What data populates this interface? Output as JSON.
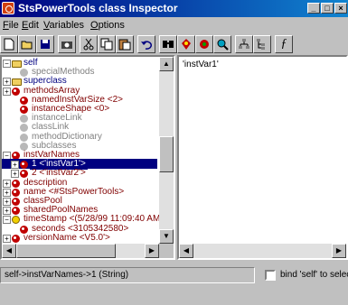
{
  "window": {
    "title": "StsPowerTools class Inspector"
  },
  "menu": [
    {
      "label": "File",
      "ul": "F",
      "rest": "ile"
    },
    {
      "label": "Edit",
      "ul": "E",
      "rest": "dit"
    },
    {
      "label": "Variables",
      "ul": "V",
      "rest": "ariables"
    },
    {
      "label": "Options",
      "ul": "O",
      "rest": "ptions"
    }
  ],
  "toolbar": {
    "items": [
      "new-icon",
      "open-icon",
      "save-icon",
      "camera-icon",
      "cut-icon",
      "copy-icon",
      "paste-icon",
      "undo-icon",
      "find-icon",
      "inspect-icon",
      "browse-icon",
      "search-icon",
      "hierarchy-icon",
      "tree-icon",
      "function-icon"
    ],
    "function_glyph": "ƒ"
  },
  "tree": [
    {
      "label": "self",
      "icon": "folder",
      "exp": "−",
      "indent": 0,
      "color": "blue"
    },
    {
      "label": "specialMethods",
      "icon": "gray",
      "exp": "",
      "indent": 1,
      "color": "gray"
    },
    {
      "label": "superclass",
      "icon": "folder",
      "exp": "+",
      "indent": 0,
      "color": "blue"
    },
    {
      "label": "methodsArray",
      "icon": "red",
      "exp": "+",
      "indent": 0,
      "color": "red"
    },
    {
      "label": "namedInstVarSize <2>",
      "icon": "red",
      "exp": "",
      "indent": 1,
      "color": "red"
    },
    {
      "label": "instanceShape <0>",
      "icon": "red",
      "exp": "",
      "indent": 1,
      "color": "red"
    },
    {
      "label": "instanceLink",
      "icon": "gray",
      "exp": "",
      "indent": 1,
      "color": "gray"
    },
    {
      "label": "classLink",
      "icon": "gray",
      "exp": "",
      "indent": 1,
      "color": "gray"
    },
    {
      "label": "methodDictionary",
      "icon": "gray",
      "exp": "",
      "indent": 1,
      "color": "gray"
    },
    {
      "label": "subclasses",
      "icon": "gray",
      "exp": "",
      "indent": 1,
      "color": "gray"
    },
    {
      "label": "instVarNames",
      "icon": "red",
      "exp": "−",
      "indent": 0,
      "color": "red"
    },
    {
      "label": "1 <'instVar1'>",
      "icon": "red",
      "exp": "+",
      "indent": 1,
      "color": "red",
      "selected": true
    },
    {
      "label": "2 <'instVar2'>",
      "icon": "red",
      "exp": "+",
      "indent": 1,
      "color": "red"
    },
    {
      "label": "description",
      "icon": "red",
      "exp": "+",
      "indent": 0,
      "color": "red"
    },
    {
      "label": "name <#StsPowerTools>",
      "icon": "red",
      "exp": "+",
      "indent": 0,
      "color": "red"
    },
    {
      "label": "classPool",
      "icon": "red",
      "exp": "+",
      "indent": 0,
      "color": "red"
    },
    {
      "label": "sharedPoolNames",
      "icon": "red",
      "exp": "+",
      "indent": 0,
      "color": "red"
    },
    {
      "label": "timeStamp <(5/28/99 11:09:40 AM",
      "icon": "clock",
      "exp": "−",
      "indent": 0,
      "color": "red"
    },
    {
      "label": "seconds <3105342580>",
      "icon": "red",
      "exp": "",
      "indent": 1,
      "color": "red"
    },
    {
      "label": "versionName <V5.0'>",
      "icon": "red",
      "exp": "+",
      "indent": 0,
      "color": "red"
    }
  ],
  "value_pane": {
    "text": "'instVar1'"
  },
  "status": {
    "path": "self->instVarNames->1 (String)",
    "bind_label": "bind 'self' to selection"
  }
}
